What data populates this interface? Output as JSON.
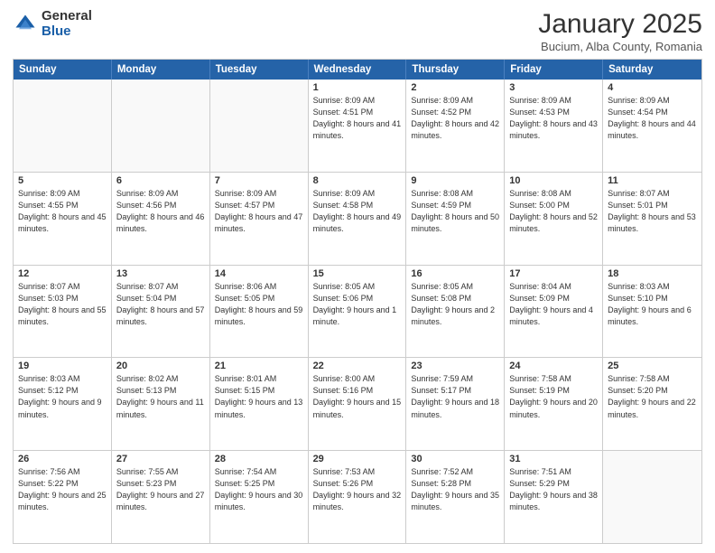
{
  "logo": {
    "general": "General",
    "blue": "Blue"
  },
  "header": {
    "month": "January 2025",
    "location": "Bucium, Alba County, Romania"
  },
  "weekdays": [
    "Sunday",
    "Monday",
    "Tuesday",
    "Wednesday",
    "Thursday",
    "Friday",
    "Saturday"
  ],
  "weeks": [
    [
      {
        "day": "",
        "empty": true
      },
      {
        "day": "",
        "empty": true
      },
      {
        "day": "",
        "empty": true
      },
      {
        "day": "1",
        "sunrise": "8:09 AM",
        "sunset": "4:51 PM",
        "daylight": "8 hours and 41 minutes."
      },
      {
        "day": "2",
        "sunrise": "8:09 AM",
        "sunset": "4:52 PM",
        "daylight": "8 hours and 42 minutes."
      },
      {
        "day": "3",
        "sunrise": "8:09 AM",
        "sunset": "4:53 PM",
        "daylight": "8 hours and 43 minutes."
      },
      {
        "day": "4",
        "sunrise": "8:09 AM",
        "sunset": "4:54 PM",
        "daylight": "8 hours and 44 minutes."
      }
    ],
    [
      {
        "day": "5",
        "sunrise": "8:09 AM",
        "sunset": "4:55 PM",
        "daylight": "8 hours and 45 minutes."
      },
      {
        "day": "6",
        "sunrise": "8:09 AM",
        "sunset": "4:56 PM",
        "daylight": "8 hours and 46 minutes."
      },
      {
        "day": "7",
        "sunrise": "8:09 AM",
        "sunset": "4:57 PM",
        "daylight": "8 hours and 47 minutes."
      },
      {
        "day": "8",
        "sunrise": "8:09 AM",
        "sunset": "4:58 PM",
        "daylight": "8 hours and 49 minutes."
      },
      {
        "day": "9",
        "sunrise": "8:08 AM",
        "sunset": "4:59 PM",
        "daylight": "8 hours and 50 minutes."
      },
      {
        "day": "10",
        "sunrise": "8:08 AM",
        "sunset": "5:00 PM",
        "daylight": "8 hours and 52 minutes."
      },
      {
        "day": "11",
        "sunrise": "8:07 AM",
        "sunset": "5:01 PM",
        "daylight": "8 hours and 53 minutes."
      }
    ],
    [
      {
        "day": "12",
        "sunrise": "8:07 AM",
        "sunset": "5:03 PM",
        "daylight": "8 hours and 55 minutes."
      },
      {
        "day": "13",
        "sunrise": "8:07 AM",
        "sunset": "5:04 PM",
        "daylight": "8 hours and 57 minutes."
      },
      {
        "day": "14",
        "sunrise": "8:06 AM",
        "sunset": "5:05 PM",
        "daylight": "8 hours and 59 minutes."
      },
      {
        "day": "15",
        "sunrise": "8:05 AM",
        "sunset": "5:06 PM",
        "daylight": "9 hours and 1 minute."
      },
      {
        "day": "16",
        "sunrise": "8:05 AM",
        "sunset": "5:08 PM",
        "daylight": "9 hours and 2 minutes."
      },
      {
        "day": "17",
        "sunrise": "8:04 AM",
        "sunset": "5:09 PM",
        "daylight": "9 hours and 4 minutes."
      },
      {
        "day": "18",
        "sunrise": "8:03 AM",
        "sunset": "5:10 PM",
        "daylight": "9 hours and 6 minutes."
      }
    ],
    [
      {
        "day": "19",
        "sunrise": "8:03 AM",
        "sunset": "5:12 PM",
        "daylight": "9 hours and 9 minutes."
      },
      {
        "day": "20",
        "sunrise": "8:02 AM",
        "sunset": "5:13 PM",
        "daylight": "9 hours and 11 minutes."
      },
      {
        "day": "21",
        "sunrise": "8:01 AM",
        "sunset": "5:15 PM",
        "daylight": "9 hours and 13 minutes."
      },
      {
        "day": "22",
        "sunrise": "8:00 AM",
        "sunset": "5:16 PM",
        "daylight": "9 hours and 15 minutes."
      },
      {
        "day": "23",
        "sunrise": "7:59 AM",
        "sunset": "5:17 PM",
        "daylight": "9 hours and 18 minutes."
      },
      {
        "day": "24",
        "sunrise": "7:58 AM",
        "sunset": "5:19 PM",
        "daylight": "9 hours and 20 minutes."
      },
      {
        "day": "25",
        "sunrise": "7:58 AM",
        "sunset": "5:20 PM",
        "daylight": "9 hours and 22 minutes."
      }
    ],
    [
      {
        "day": "26",
        "sunrise": "7:56 AM",
        "sunset": "5:22 PM",
        "daylight": "9 hours and 25 minutes."
      },
      {
        "day": "27",
        "sunrise": "7:55 AM",
        "sunset": "5:23 PM",
        "daylight": "9 hours and 27 minutes."
      },
      {
        "day": "28",
        "sunrise": "7:54 AM",
        "sunset": "5:25 PM",
        "daylight": "9 hours and 30 minutes."
      },
      {
        "day": "29",
        "sunrise": "7:53 AM",
        "sunset": "5:26 PM",
        "daylight": "9 hours and 32 minutes."
      },
      {
        "day": "30",
        "sunrise": "7:52 AM",
        "sunset": "5:28 PM",
        "daylight": "9 hours and 35 minutes."
      },
      {
        "day": "31",
        "sunrise": "7:51 AM",
        "sunset": "5:29 PM",
        "daylight": "9 hours and 38 minutes."
      },
      {
        "day": "",
        "empty": true
      }
    ]
  ]
}
